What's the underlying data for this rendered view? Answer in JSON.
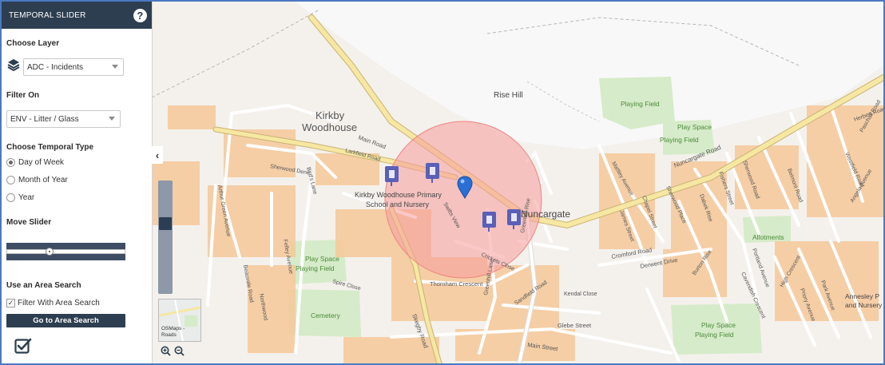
{
  "panel": {
    "title": "TEMPORAL SLIDER",
    "help_icon": "?",
    "choose_layer_label": "Choose Layer",
    "layer_value": "ADC - Incidents",
    "filter_on_label": "Filter On",
    "filter_value": "ENV - Litter / Glass",
    "temporal_type_label": "Choose Temporal Type",
    "temporal_options": [
      "Day of Week",
      "Month of Year",
      "Year"
    ],
    "temporal_selected": "Day of Week",
    "move_slider_label": "Move Slider",
    "slider_position": 0.35,
    "area_search_label": "Use an Area Search",
    "filter_area_label": "Filter With Area Search",
    "filter_area_checked": true,
    "go_area_button": "Go to Area Search"
  },
  "map_controls": {
    "collapse_icon": "chevron-left-icon",
    "zoom_level_fraction": 0.35,
    "basemap_label": "OSMaps - Roads",
    "basemap_label_line1": "OSMaps -",
    "basemap_label_line2": "Roads",
    "zoom_in_icon": "zoom-in-icon",
    "zoom_out_icon": "zoom-out-icon"
  },
  "map": {
    "labels": {
      "kirkby1": "Kirkby",
      "kirkby2": "Woodhouse",
      "rise_hill": "Rise Hill",
      "playing_field_1": "Playing Field",
      "play_space_1": "Play Space",
      "playing_field_2": "Playing Field",
      "school1": "Kirkby Woodhouse Primary",
      "school2": "School and Nursery",
      "nuncargate": "Nuncargate",
      "nuncargate_road": "Nuncargate Road",
      "main_road": "Main Road",
      "larkfield_road": "Larkfield Road",
      "sherwood_drive": "Sherwood Dene",
      "birds_lane": "Bird's Lane",
      "arthur_green_avenue": "Arthur Green Avenue",
      "felley_avenue": "Felley Avenue",
      "beauvale_road": "Beauvale Road",
      "northwood": "Northwood",
      "spire_close": "Spire Close",
      "play_space_2": "Play Space",
      "playing_field_3": "Playing Field",
      "cemetery": "Cemetery",
      "skegby_road": "Skegby Road",
      "thornham_crescent": "Thornham Crescent",
      "greenhill_lane": "Greenhill Lane",
      "swifts_view": "Swifts View",
      "crickets_close": "Crickets Close",
      "greenhill_rise": "Greenhill Rise",
      "sandfield_road": "Sandfield Road",
      "kendal_close": "Kendal Close",
      "glebe_street": "Glebe Street",
      "main_street": "Main Street",
      "mattley_avenue": "Mattley Avenue",
      "james_street": "James Street",
      "chapel_street": "Chapel Street",
      "sherwood_place": "Sherwood Place",
      "dabek_rise": "Dabek Rise",
      "fishers_street": "Fishers Street",
      "cromford_road": "Cromford Road",
      "derwent_drive": "Derwent Drive",
      "burton_rise": "Burton Rise",
      "cavendish_crescent": "Cavendish Crescent",
      "portland_avenue": "Portland Avenue",
      "allotments": "Allotments",
      "play_space_3": "Play Space",
      "playing_field_4": "Playing Field",
      "highcrescent": "High Crescent",
      "priory_avenue": "Priory Avenue",
      "park_avenue": "Park Avenue",
      "sherwood_road": "Sherwood Road",
      "belmont_road": "Belmont Road",
      "westfield_road": "Westfield Road",
      "angela_avenue": "Angela Avenue",
      "herbert_road": "Herbert Road",
      "paschall_road": "Paschall Road",
      "annesley1": "Annesley P",
      "annesley2": "and Nursery"
    }
  },
  "colors": {
    "panel_header": "#2d3e50",
    "buffer_fill": "#f59a9a",
    "main_road": "#f6e7a2",
    "marker": "#2a6fd6",
    "incident_icon": "#5a5fb8",
    "green_area": "#d6ebc9"
  }
}
